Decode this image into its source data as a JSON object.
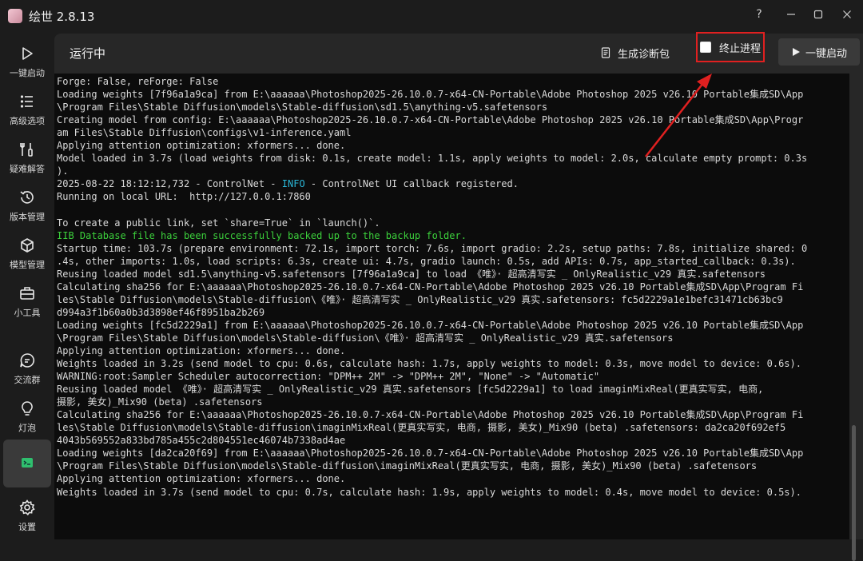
{
  "window": {
    "title": "绘世 2.8.13",
    "controls": [
      "help-icon",
      "minimize-icon",
      "maximize-icon",
      "close-icon"
    ],
    "help_label": "?"
  },
  "sidebar": {
    "items": [
      {
        "label": "一键启动",
        "icon": "play-icon"
      },
      {
        "label": "高级选项",
        "icon": "list-icon"
      },
      {
        "label": "疑难解答",
        "icon": "tools-icon"
      },
      {
        "label": "版本管理",
        "icon": "history-icon"
      },
      {
        "label": "模型管理",
        "icon": "cube-icon"
      },
      {
        "label": "小工具",
        "icon": "toolbox-icon"
      },
      {
        "label": "交流群",
        "icon": "chat-icon"
      },
      {
        "label": "灯泡",
        "icon": "bulb-icon"
      },
      {
        "label": "",
        "icon": "console-icon",
        "active": true
      },
      {
        "label": "设置",
        "icon": "gear-icon"
      }
    ]
  },
  "header": {
    "title": "运行中",
    "diag_label": "生成诊断包",
    "kill_label": "终止进程",
    "launch_label": "一键启动"
  },
  "console": {
    "lines": [
      {
        "t": "Forge: False, reForge: False"
      },
      {
        "t": "Loading weights [7f96a1a9ca] from E:\\aaaaaa\\Photoshop2025-26.10.0.7-x64-CN-Portable\\Adobe Photoshop 2025 v26.10 Portable集成SD\\App"
      },
      {
        "t": "\\Program Files\\Stable Diffusion\\models\\Stable-diffusion\\sd1.5\\anything-v5.safetensors"
      },
      {
        "t": "Creating model from config: E:\\aaaaaa\\Photoshop2025-26.10.0.7-x64-CN-Portable\\Adobe Photoshop 2025 v26.10 Portable集成SD\\App\\Progr"
      },
      {
        "t": "am Files\\Stable Diffusion\\configs\\v1-inference.yaml"
      },
      {
        "t": "Applying attention optimization: xformers... done."
      },
      {
        "t": "Model loaded in 3.7s (load weights from disk: 0.1s, create model: 1.1s, apply weights to model: 2.0s, calculate empty prompt: 0.3s"
      },
      {
        "t": ")."
      },
      {
        "t": "2025-08-22 18:12:12,732 - ControlNet - ",
        "hl": "INFO",
        "t2": " - ControlNet UI callback registered."
      },
      {
        "t": "Running on local URL:  http://127.0.0.1:7860"
      },
      {
        "t": ""
      },
      {
        "t": "To create a public link, set `share=True` in `launch()`."
      },
      {
        "t": "IIB Database file has been successfully backed up to the backup folder.",
        "green": true
      },
      {
        "t": "Startup time: 103.7s (prepare environment: 72.1s, import torch: 7.6s, import gradio: 2.2s, setup paths: 7.8s, initialize shared: 0"
      },
      {
        "t": ".4s, other imports: 1.0s, load scripts: 6.3s, create ui: 4.7s, gradio launch: 0.5s, add APIs: 0.7s, app_started_callback: 0.3s)."
      },
      {
        "t": "Reusing loaded model sd1.5\\anything-v5.safetensors [7f96a1a9ca] to load 《唯》· 超高清写实 _ OnlyRealistic_v29 真实.safetensors"
      },
      {
        "t": "Calculating sha256 for E:\\aaaaaa\\Photoshop2025-26.10.0.7-x64-CN-Portable\\Adobe Photoshop 2025 v26.10 Portable集成SD\\App\\Program Fi"
      },
      {
        "t": "les\\Stable Diffusion\\models\\Stable-diffusion\\《唯》· 超高清写实 _ OnlyRealistic_v29 真实.safetensors: fc5d2229a1e1befc31471cb63bc9"
      },
      {
        "t": "d994a3f1b60a0b3d3898ef46f8951ba2b269"
      },
      {
        "t": "Loading weights [fc5d2229a1] from E:\\aaaaaa\\Photoshop2025-26.10.0.7-x64-CN-Portable\\Adobe Photoshop 2025 v26.10 Portable集成SD\\App"
      },
      {
        "t": "\\Program Files\\Stable Diffusion\\models\\Stable-diffusion\\《唯》· 超高清写实 _ OnlyRealistic_v29 真实.safetensors"
      },
      {
        "t": "Applying attention optimization: xformers... done."
      },
      {
        "t": "Weights loaded in 3.2s (send model to cpu: 0.6s, calculate hash: 1.7s, apply weights to model: 0.3s, move model to device: 0.6s)."
      },
      {
        "t": "WARNING:root:Sampler Scheduler autocorrection: \"DPM++ 2M\" -> \"DPM++ 2M\", \"None\" -> \"Automatic\""
      },
      {
        "t": "Reusing loaded model 《唯》· 超高清写实 _ OnlyRealistic_v29 真实.safetensors [fc5d2229a1] to load imaginMixReal(更真实写实, 电商,"
      },
      {
        "t": "摄影, 美女)_Mix90 (beta) .safetensors"
      },
      {
        "t": "Calculating sha256 for E:\\aaaaaa\\Photoshop2025-26.10.0.7-x64-CN-Portable\\Adobe Photoshop 2025 v26.10 Portable集成SD\\App\\Program Fi"
      },
      {
        "t": "les\\Stable Diffusion\\models\\Stable-diffusion\\imaginMixReal(更真实写实, 电商, 摄影, 美女)_Mix90 (beta) .safetensors: da2ca20f692ef5"
      },
      {
        "t": "4043b569552a833bd785a455c2d804551ec46074b7338ad4ae"
      },
      {
        "t": "Loading weights [da2ca20f69] from E:\\aaaaaa\\Photoshop2025-26.10.0.7-x64-CN-Portable\\Adobe Photoshop 2025 v26.10 Portable集成SD\\App"
      },
      {
        "t": "\\Program Files\\Stable Diffusion\\models\\Stable-diffusion\\imaginMixReal(更真实写实, 电商, 摄影, 美女)_Mix90 (beta) .safetensors"
      },
      {
        "t": "Applying attention optimization: xformers... done."
      },
      {
        "t": "Weights loaded in 3.7s (send model to cpu: 0.7s, calculate hash: 1.9s, apply weights to model: 0.4s, move model to device: 0.5s)."
      }
    ]
  },
  "colors": {
    "annotation_red": "#e02020",
    "log_green": "#3cd13c",
    "log_info_cyan": "#2ab7d8"
  }
}
